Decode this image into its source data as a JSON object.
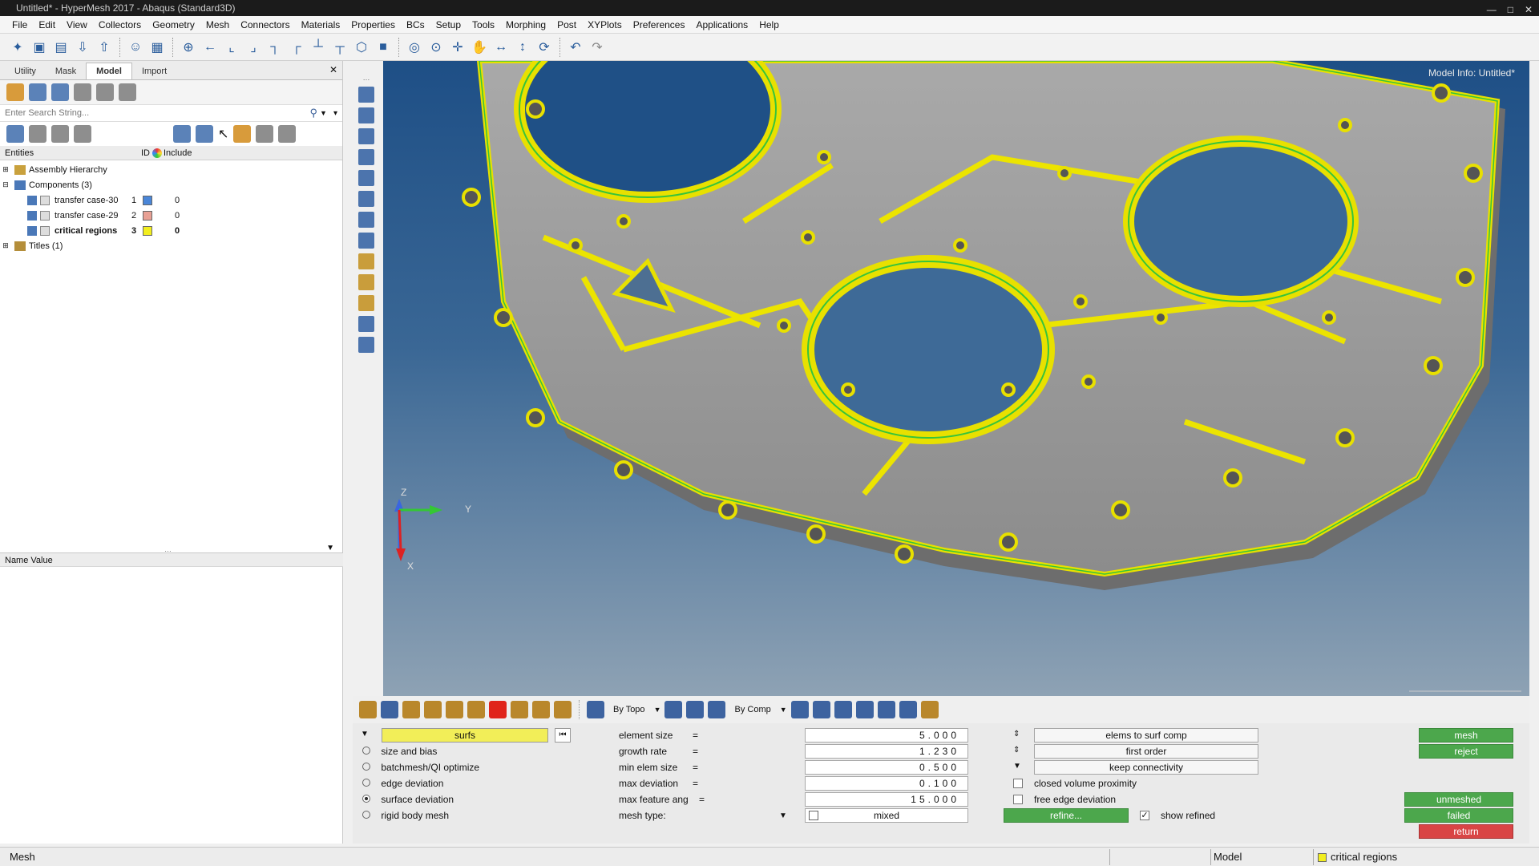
{
  "window": {
    "title": "Untitled* - HyperMesh 2017 - Abaqus (Standard3D)"
  },
  "menu": [
    "File",
    "Edit",
    "View",
    "Collectors",
    "Geometry",
    "Mesh",
    "Connectors",
    "Materials",
    "Properties",
    "BCs",
    "Setup",
    "Tools",
    "Morphing",
    "Post",
    "XYPlots",
    "Preferences",
    "Applications",
    "Help"
  ],
  "tabs": [
    "Utility",
    "Mask",
    "Model",
    "Import"
  ],
  "search": {
    "placeholder": "Enter Search String..."
  },
  "tree": {
    "headers": {
      "entities": "Entities",
      "id": "ID",
      "include": "Include"
    },
    "assembly": "Assembly Hierarchy",
    "components": "Components (3)",
    "items": [
      {
        "name": "transfer case-30",
        "id": "1",
        "include": "0",
        "color": "#4a86d8"
      },
      {
        "name": "transfer case-29",
        "id": "2",
        "include": "0",
        "color": "#e8a094"
      },
      {
        "name": "critical regions",
        "id": "3",
        "include": "0",
        "color": "#f2ee1f"
      }
    ],
    "titles": "Titles (1)"
  },
  "namevalue": {
    "label": "Name Value"
  },
  "viewport": {
    "model_info": "Model Info: Untitled*",
    "axis_z": "Z",
    "axis_y": "Y",
    "axis_x": "X"
  },
  "bottom_toolbar": {
    "by_topo": "By Topo",
    "by_comp": "By Comp"
  },
  "panel": {
    "selector": "surfs",
    "options": [
      {
        "label": "size and bias",
        "selected": false
      },
      {
        "label": "batchmesh/QI optimize",
        "selected": false
      },
      {
        "label": "edge deviation",
        "selected": false
      },
      {
        "label": "surface deviation",
        "selected": true
      },
      {
        "label": "rigid body mesh",
        "selected": false
      }
    ],
    "params": [
      {
        "label": "element size",
        "eq": "=",
        "value": "5.000"
      },
      {
        "label": "growth rate",
        "eq": "=",
        "value": "1.230"
      },
      {
        "label": "min elem size",
        "eq": "=",
        "value": "0.500"
      },
      {
        "label": "max deviation",
        "eq": "=",
        "value": "0.100"
      },
      {
        "label": "max feature ang",
        "eq": "=",
        "value": "15.000"
      }
    ],
    "mesh_type_label": "mesh type:",
    "mesh_type_value": "mixed",
    "options_right": {
      "elems_to_surf_comp": "elems to surf comp",
      "first_order": "first order",
      "keep_connectivity": "keep connectivity",
      "closed_volume_proximity": "closed volume proximity",
      "free_edge_deviation": "free edge deviation",
      "refine": "refine...",
      "show_refined": "show refined",
      "show_refined_checked": true
    },
    "actions": {
      "mesh": "mesh",
      "reject": "reject",
      "unmeshed": "unmeshed",
      "failed": "failed",
      "return": "return"
    }
  },
  "status": {
    "mode": "Mesh",
    "view": "Model",
    "component": "critical regions"
  }
}
